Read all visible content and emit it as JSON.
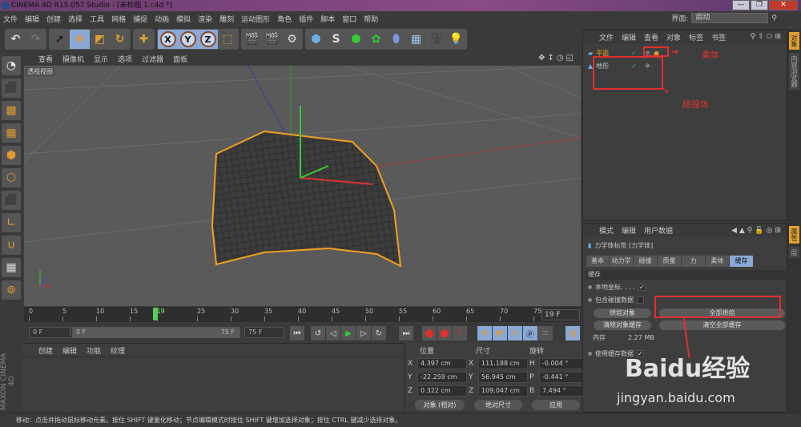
{
  "window": {
    "title": "CINEMA 4D R15.057 Studio - [未标题 1.c4d *]",
    "min": "—",
    "max": "❐",
    "close": "✕"
  },
  "menu": [
    "文件",
    "编辑",
    "创建",
    "选择",
    "工具",
    "网格",
    "捕捉",
    "动画",
    "模拟",
    "渲染",
    "雕刻",
    "运动图形",
    "角色",
    "插件",
    "脚本",
    "窗口",
    "帮助"
  ],
  "layout": {
    "label": "界面:",
    "value": "启动"
  },
  "toolbar": {
    "axes": [
      "X",
      "Y",
      "Z"
    ]
  },
  "viewport": {
    "menu": [
      "查看",
      "摄像机",
      "显示",
      "选项",
      "过滤器",
      "面板"
    ],
    "label": "透视视图"
  },
  "timeline": {
    "ticks": [
      "0",
      "5",
      "10",
      "15",
      "19",
      "25",
      "30",
      "35",
      "40",
      "45",
      "50",
      "55",
      "60",
      "65",
      "70",
      "75"
    ],
    "current_frame": "19 F",
    "current": 19,
    "max": 75
  },
  "transport": {
    "start": "0 F",
    "range_start": "0 F",
    "range_end": "75 F",
    "end": "75 F"
  },
  "materials": {
    "menu": [
      "创建",
      "编辑",
      "功能",
      "纹理"
    ]
  },
  "branding": "MAXON CINEMA 4D",
  "coords": {
    "headers": [
      "位置",
      "尺寸",
      "旋转"
    ],
    "rows": [
      {
        "pa": "X",
        "p": "4.397 cm",
        "sa": "X",
        "s": "111.188 cm",
        "ra": "H",
        "r": "-0.004 °"
      },
      {
        "pa": "Y",
        "p": "-22.259 cm",
        "sa": "Y",
        "s": "56.945 cm",
        "ra": "P",
        "r": "-0.441 °"
      },
      {
        "pa": "Z",
        "p": "0.322 cm",
        "sa": "Z",
        "s": "109.047 cm",
        "ra": "B",
        "r": "7.494 °"
      }
    ],
    "mode": "对象 (相对)",
    "size_mode": "绝对尺寸",
    "apply": "应用"
  },
  "status": "移动：点击并拖动鼠标移动元素。按住 SHIFT 键量化移动；节点编辑模式时按住 SHIFT 键增加选择对象；按住 CTRL 键减少选择对象。",
  "objects": {
    "menu": [
      "文件",
      "编辑",
      "查看",
      "对象",
      "标签",
      "书签"
    ],
    "items": [
      {
        "name": "平面",
        "selected": true
      },
      {
        "name": "地形",
        "selected": false
      }
    ]
  },
  "annotations": {
    "soft": "柔体",
    "collider": "碰撞体"
  },
  "attributes": {
    "menu": [
      "模式",
      "编辑",
      "用户数据"
    ],
    "title": "力学体标签 [力学体]",
    "tabs": [
      "基本",
      "动力学",
      "碰撞",
      "质量",
      "力",
      "柔体",
      "缓存"
    ],
    "active_tab": "缓存",
    "section": "缓存",
    "local_coords": "本地坐标. . . .",
    "include_collision": "包含碰撞数据",
    "bake_object": "烘焙对象",
    "bake_all": "全部烘焙",
    "clear_object": "清除对象缓存",
    "clear_all": "清空全部缓存",
    "memory_label": "内存",
    "memory_value": "2.27 MB",
    "use_cache": "使用缓存数据"
  },
  "right_tabs": [
    "对象",
    "内容浏览器",
    "属性",
    "层"
  ],
  "watermark": {
    "brand": "Baidu经验",
    "url": "jingyan.baidu.com"
  },
  "colors": {
    "accent": "#8aa9d6",
    "highlight": "#e0a030",
    "annotation": "#e03030"
  }
}
